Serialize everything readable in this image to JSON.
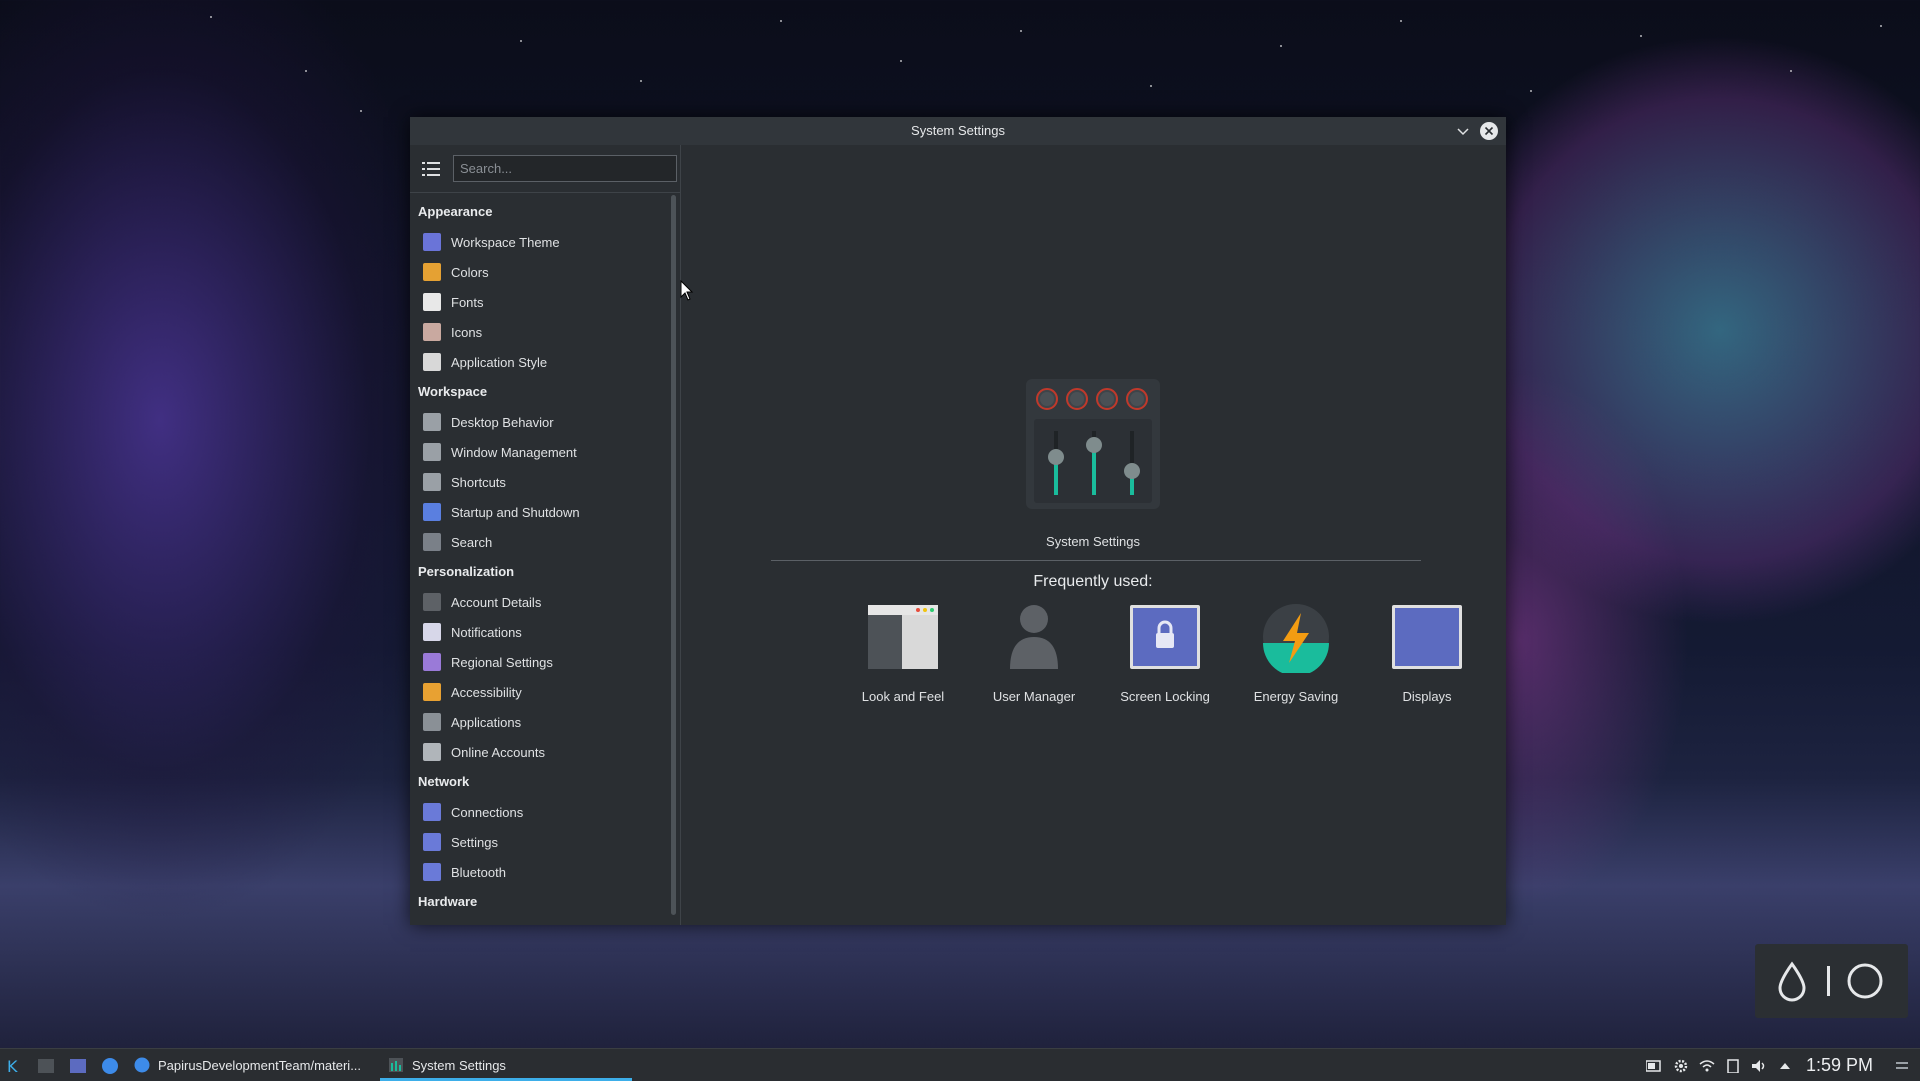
{
  "window": {
    "title": "System Settings",
    "colors": {
      "accent": "#3daee9",
      "window_bg": "#2a2e32",
      "titlebar_bg": "#31363b"
    }
  },
  "sidebar": {
    "search_placeholder": "Search...",
    "sections": [
      {
        "category": "Appearance",
        "items": [
          {
            "label": "Workspace Theme",
            "icon": "workspace-theme-icon",
            "color": "#6a74d8"
          },
          {
            "label": "Colors",
            "icon": "colors-icon",
            "color": "#e5a133"
          },
          {
            "label": "Fonts",
            "icon": "fonts-icon",
            "color": "#e8e8e8"
          },
          {
            "label": "Icons",
            "icon": "icons-icon",
            "color": "#c9a9a0"
          },
          {
            "label": "Application Style",
            "icon": "application-style-icon",
            "color": "#d8d8d8"
          }
        ]
      },
      {
        "category": "Workspace",
        "items": [
          {
            "label": "Desktop Behavior",
            "icon": "desktop-behavior-icon",
            "color": "#9aa0a6"
          },
          {
            "label": "Window Management",
            "icon": "window-management-icon",
            "color": "#9aa0a6"
          },
          {
            "label": "Shortcuts",
            "icon": "shortcuts-icon",
            "color": "#9aa0a6"
          },
          {
            "label": "Startup and Shutdown",
            "icon": "startup-shutdown-icon",
            "color": "#5a7fe0"
          },
          {
            "label": "Search",
            "icon": "search-icon",
            "color": "#7a8088"
          }
        ]
      },
      {
        "category": "Personalization",
        "items": [
          {
            "label": "Account Details",
            "icon": "account-details-icon",
            "color": "#5d6166"
          },
          {
            "label": "Notifications",
            "icon": "notifications-icon",
            "color": "#d7d7e9"
          },
          {
            "label": "Regional Settings",
            "icon": "regional-settings-icon",
            "color": "#9a7ad8"
          },
          {
            "label": "Accessibility",
            "icon": "accessibility-icon",
            "color": "#e8a132"
          },
          {
            "label": "Applications",
            "icon": "applications-icon",
            "color": "#8a9096"
          },
          {
            "label": "Online Accounts",
            "icon": "online-accounts-icon",
            "color": "#b0b5ba"
          }
        ]
      },
      {
        "category": "Network",
        "items": [
          {
            "label": "Connections",
            "icon": "connections-icon",
            "color": "#6a7ad8"
          },
          {
            "label": "Settings",
            "icon": "network-settings-icon",
            "color": "#6a7ad8"
          },
          {
            "label": "Bluetooth",
            "icon": "bluetooth-icon",
            "color": "#6a7ad8"
          }
        ]
      },
      {
        "category": "Hardware",
        "items": []
      }
    ]
  },
  "main": {
    "app_label": "System Settings",
    "frequently_used_label": "Frequently used:",
    "tiles": [
      {
        "label": "Look and Feel",
        "icon": "look-and-feel-icon"
      },
      {
        "label": "User Manager",
        "icon": "user-manager-icon"
      },
      {
        "label": "Screen Locking",
        "icon": "screen-locking-icon"
      },
      {
        "label": "Energy Saving",
        "icon": "energy-saving-icon"
      },
      {
        "label": "Displays",
        "icon": "displays-icon"
      }
    ]
  },
  "taskbar": {
    "tasks": [
      {
        "label": "PapirusDevelopmentTeam/materi...",
        "icon": "browser-icon"
      },
      {
        "label": "System Settings",
        "icon": "system-settings-icon",
        "active": true
      }
    ],
    "clock": "1:59 PM"
  }
}
